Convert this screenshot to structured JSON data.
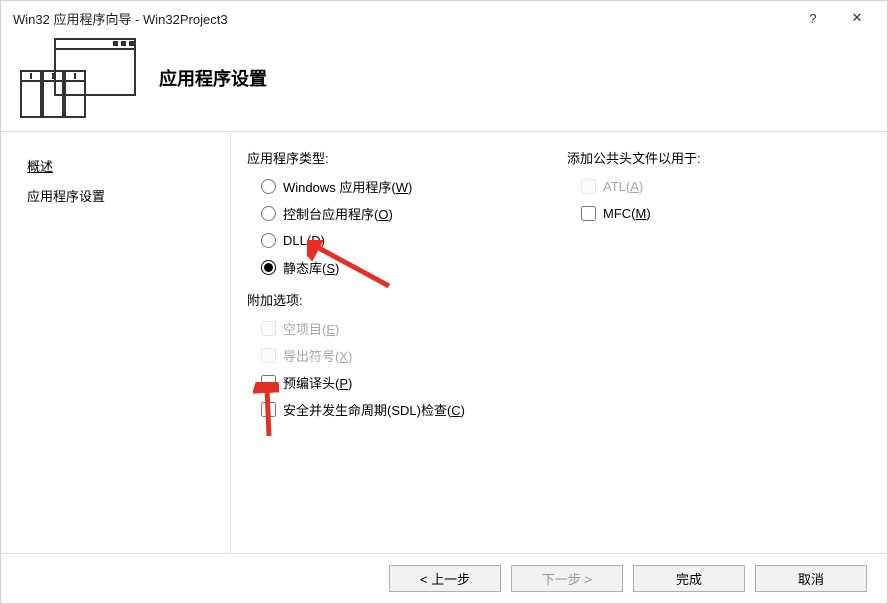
{
  "titlebar": {
    "text": "Win32 应用程序向导 - Win32Project3",
    "help": "?",
    "close": "✕"
  },
  "header": {
    "title": "应用程序设置"
  },
  "sidebar": {
    "overview": "概述",
    "settings": "应用程序设置"
  },
  "appType": {
    "label": "应用程序类型:",
    "windows": "Windows 应用程序(",
    "windows_u": "W",
    "windows_sfx": ")",
    "console": "控制台应用程序(",
    "console_u": "O",
    "console_sfx": ")",
    "dll": "DLL(",
    "dll_u": "D",
    "dll_sfx": ")",
    "static": "静态库(",
    "static_u": "S",
    "static_sfx": ")"
  },
  "extra": {
    "label": "附加选项:",
    "empty": "空项目(",
    "empty_u": "E",
    "empty_sfx": ")",
    "export": "导出符号(",
    "export_u": "X",
    "export_sfx": ")",
    "pch": "预编译头(",
    "pch_u": "P",
    "pch_sfx": ")",
    "sdl": "安全并发生命周期(SDL)检查(",
    "sdl_u": "C",
    "sdl_sfx": ")"
  },
  "headers": {
    "label": "添加公共头文件以用于:",
    "atl": "ATL(",
    "atl_u": "A",
    "atl_sfx": ")",
    "mfc": "MFC(",
    "mfc_u": "M",
    "mfc_sfx": ")"
  },
  "buttons": {
    "prev": "< 上一步",
    "next": "下一步 >",
    "finish": "完成",
    "cancel": "取消"
  }
}
